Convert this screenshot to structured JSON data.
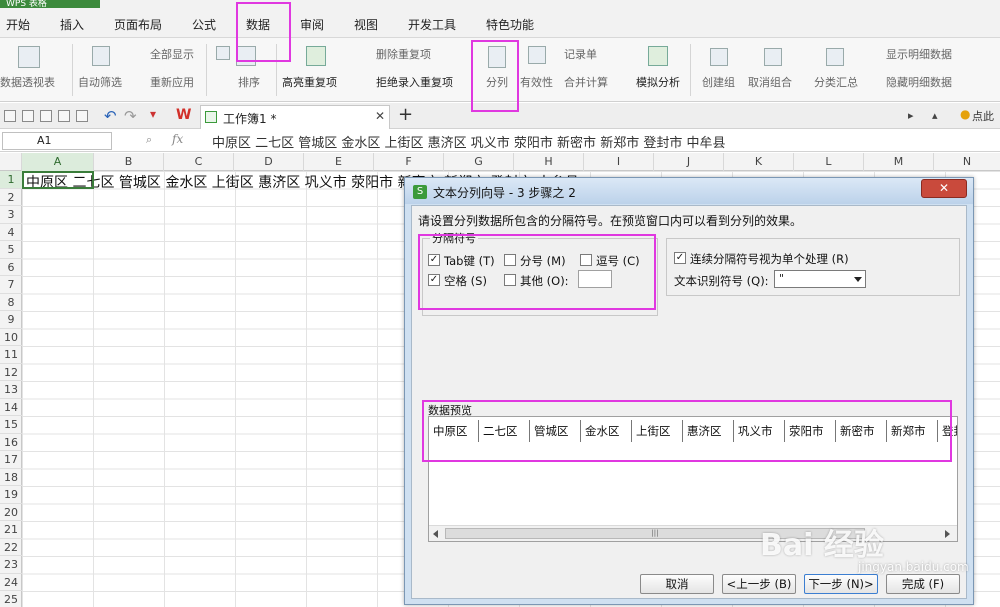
{
  "app": {
    "brand": "WPS 表格"
  },
  "menu": [
    "开始",
    "插入",
    "页面布局",
    "公式",
    "数据",
    "审阅",
    "视图",
    "开发工具",
    "特色功能"
  ],
  "ribbon": {
    "pivot": "数据透视表",
    "autofilter": "自动筛选",
    "show_all": "全部显示",
    "reapply": "重新应用",
    "sort": "排序",
    "highlight_dup": "高亮重复项",
    "remove_dup": "删除重复项",
    "reject_dup": "拒绝录入重复项",
    "split": "分列",
    "validity": "有效性",
    "record": "记录单",
    "merge_calc": "合并计算",
    "sim_analysis": "模拟分析",
    "create_group": "创建组",
    "ungroup": "取消组合",
    "subtotal": "分类汇总",
    "show_detail": "显示明细数据",
    "hide_detail": "隐藏明细数据"
  },
  "doc_tab": {
    "title": "工作簿1 *",
    "click_text": "点此"
  },
  "formula_bar": {
    "name_box": "A1",
    "fx": "fx",
    "content": "中原区 二七区 管城区 金水区 上街区 惠济区 巩义市 荥阳市 新密市 新郑市 登封市 中牟县"
  },
  "columns": [
    "A",
    "B",
    "C",
    "D",
    "E",
    "F",
    "G",
    "H",
    "I",
    "J",
    "K",
    "L",
    "M",
    "N"
  ],
  "rows": [
    "1",
    "2",
    "3",
    "4",
    "5",
    "6",
    "7",
    "8",
    "9",
    "10",
    "11",
    "12",
    "13",
    "14",
    "15",
    "16",
    "17",
    "18",
    "19",
    "20",
    "21",
    "22",
    "23",
    "24",
    "25"
  ],
  "sheet": {
    "row1": "中原区 二七区 管城区 金水区 上街区 惠济区 巩义市 荥阳市 新密市 新郑市 登封市 中牟县"
  },
  "dialog": {
    "title": "文本分列向导 - 3 步骤之 2",
    "close": "✕",
    "description": "请设置分列数据所包含的分隔符号。在预览窗口内可以看到分列的效果。",
    "delim_group": "分隔符号",
    "tab": "Tab键 (T)",
    "semicolon": "分号 (M)",
    "comma": "逗号 (C)",
    "space": "空格 (S)",
    "other": "其他 (O):",
    "consecutive": "连续分隔符号视为单个处理 (R)",
    "qualifier_label": "文本识别符号 (Q):",
    "qualifier_value": "\"",
    "preview_label": "数据预览",
    "preview_cells": [
      "中原区",
      "二七区",
      "管城区",
      "金水区",
      "上街区",
      "惠济区",
      "巩义市",
      "荥阳市",
      "新密市",
      "新郑市",
      "登封"
    ],
    "scroll_grip": "|||",
    "btn_cancel": "取消",
    "btn_back": "<上一步 (B)",
    "btn_next": "下一步 (N)>",
    "btn_finish": "完成 (F)",
    "checked": {
      "tab": true,
      "semicolon": false,
      "comma": false,
      "space": true,
      "other": false,
      "consecutive": true
    }
  },
  "watermark": {
    "text": "Bai 经验",
    "sub": "jingyan.baidu.com"
  },
  "colors": {
    "highlight": "#e038e0",
    "title_bar": "#bcd2ea",
    "close": "#c94a3c",
    "cell_border": "#3a7d3a"
  }
}
